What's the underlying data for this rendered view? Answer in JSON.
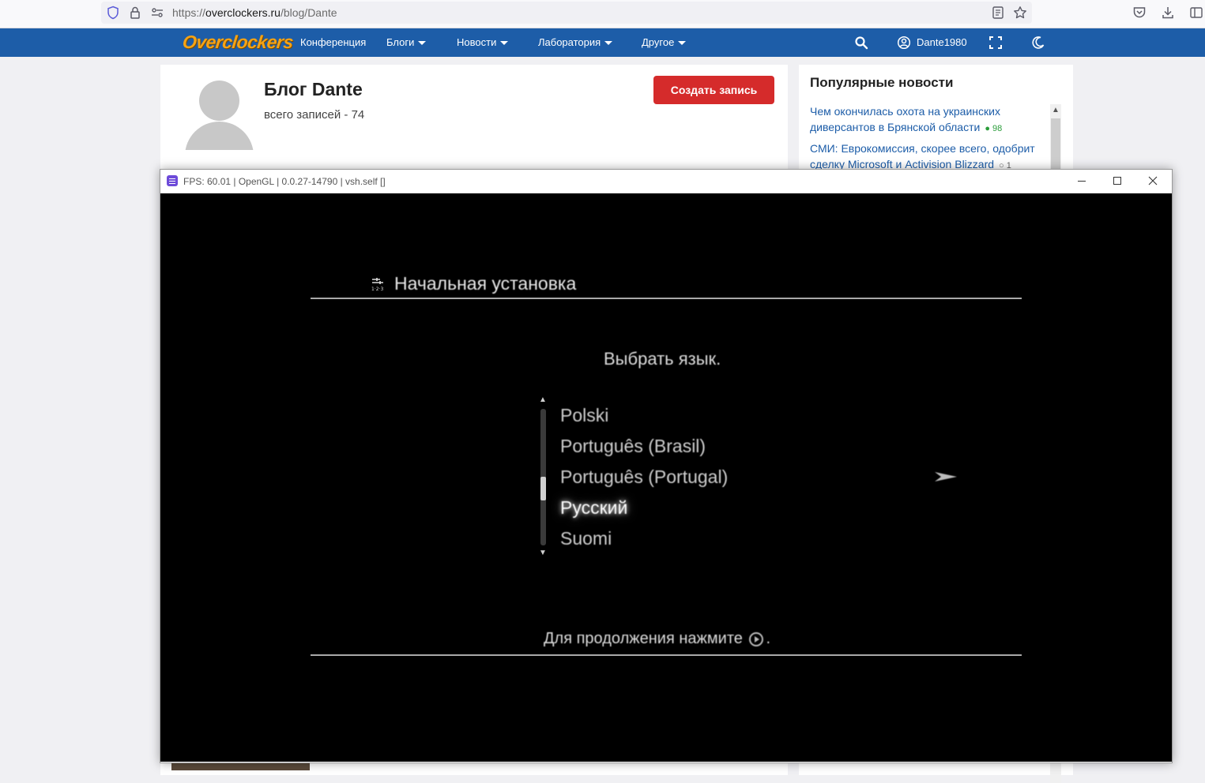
{
  "browser": {
    "url_prefix": "https://",
    "url_domain": "overclockers.ru",
    "url_path": "/blog/Dante"
  },
  "site": {
    "logo": "Overclockers",
    "nav": [
      "Конференция",
      "Блоги",
      "Новости",
      "Лаборатория",
      "Другое"
    ],
    "username": "Dante1980"
  },
  "blog": {
    "title": "Блог Dante",
    "count": "всего записей - 74",
    "create_button": "Создать запись"
  },
  "sidebar": {
    "title": "Популярные новости",
    "news": [
      {
        "text": "Чем окончилась охота на украинских диверсантов в Брянской области",
        "comments": "98"
      },
      {
        "text": "СМИ: Еврокомиссия, скорее всего, одобрит сделку Microsoft и Activision Blizzard",
        "comments": "1"
      }
    ]
  },
  "emulator": {
    "title": "FPS: 60.01 | OpenGL | 0.0.27-14790 | vsh.self []",
    "setup_title": "Начальная установка",
    "prompt": "Выбрать язык.",
    "languages": [
      "Polski",
      "Português (Brasil)",
      "Português (Portugal)",
      "Русский",
      "Suomi"
    ],
    "selected_language": "Русский",
    "continue_before": "Для продолжения нажмите",
    "continue_after": "."
  },
  "colors": {
    "nav_bg": "#1d5da8",
    "logo": "#f5a315",
    "create_button": "#d52b2b",
    "link": "#1d5da8",
    "emulator_bg": "#000000"
  }
}
